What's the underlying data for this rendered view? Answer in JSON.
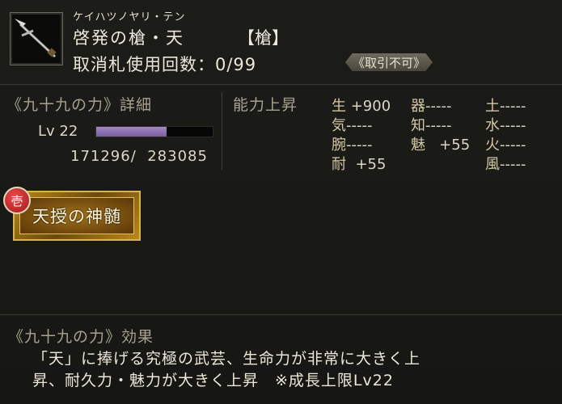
{
  "item": {
    "ruby": "ケイハツノヤリ・テン",
    "name": "啓発の槍・天",
    "type": "【槍】",
    "cancel_label": "取消札使用回数：0/99",
    "trade_badge": "《取引不可》",
    "icon": "spear-icon"
  },
  "growth": {
    "title": "《九十九の力》詳細",
    "level": "Lv 22",
    "exp_text": "171296/  283085",
    "exp_fraction": 0.605
  },
  "stats": {
    "title": "能力上昇",
    "items": [
      {
        "k": "生",
        "v": " +900"
      },
      {
        "k": "器",
        "v": "-----"
      },
      {
        "k": "土",
        "v": "-----"
      },
      {
        "k": "気",
        "v": "-----"
      },
      {
        "k": "知",
        "v": "-----"
      },
      {
        "k": "水",
        "v": "-----"
      },
      {
        "k": "腕",
        "v": "-----"
      },
      {
        "k": "魅",
        "v": "   +55"
      },
      {
        "k": "火",
        "v": "-----"
      },
      {
        "k": "耐",
        "v": "  +55"
      },
      {
        "k": "風",
        "v": "-----"
      }
    ]
  },
  "skill": {
    "badge": "壱",
    "label": "天授の神髄"
  },
  "effect": {
    "title": "《九十九の力》効果",
    "line1": "「天」に捧げる究極の武芸、生命力が非常に大きく上",
    "line2": "昇、耐久力・魅力が大きく上昇　※成長上限Lv22"
  },
  "colors": {
    "background": "#191916",
    "exp_bar": "#9277b4",
    "skill_gold": "#b88a18",
    "badge_red": "#c22626"
  }
}
